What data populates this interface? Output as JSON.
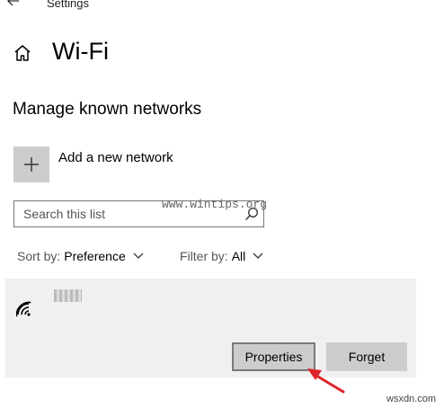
{
  "header": {
    "back_icon": "back-arrow-icon",
    "title": "Settings"
  },
  "page": {
    "home_icon": "home-icon",
    "title": "Wi-Fi"
  },
  "section": {
    "title": "Manage known networks"
  },
  "add_network": {
    "icon": "plus-icon",
    "label": "Add a new network"
  },
  "search": {
    "placeholder": "Search this list",
    "icon": "search-icon"
  },
  "sort": {
    "label": "Sort by:",
    "value": "Preference"
  },
  "filter": {
    "label": "Filter by:",
    "value": "All"
  },
  "network": {
    "icon": "wifi-secured-icon",
    "buttons": {
      "properties": "Properties",
      "forget": "Forget"
    }
  },
  "watermarks": {
    "site": "www.wintips.org",
    "corner": "wsxdn.com"
  },
  "colors": {
    "tile": "#cccccc",
    "panel": "#f0f0f0",
    "arrow": "#e0242b"
  }
}
